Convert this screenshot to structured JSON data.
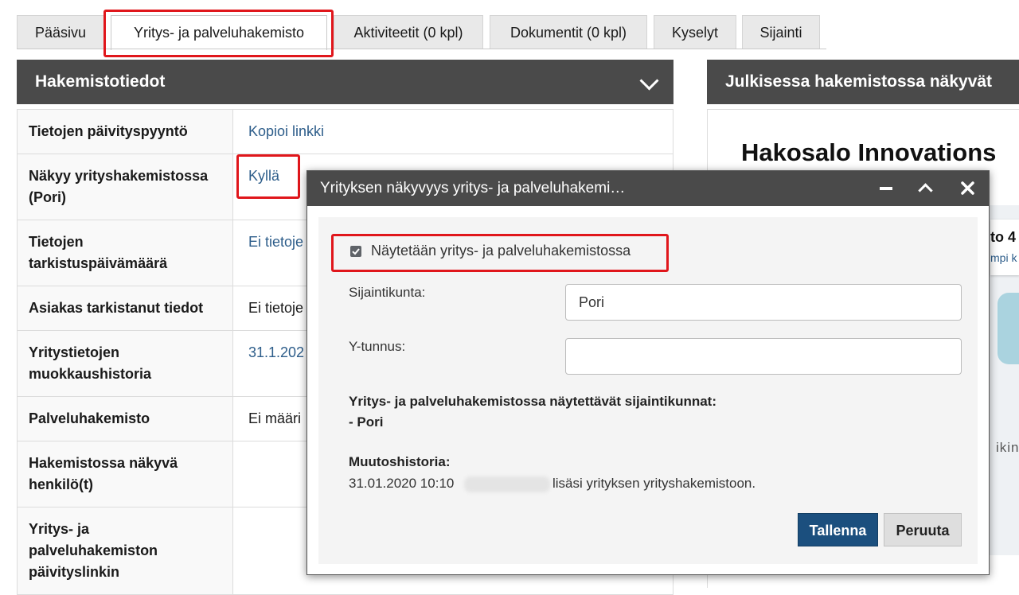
{
  "tabs": [
    {
      "label": "Pääsivu"
    },
    {
      "label": "Yritys- ja palveluhakemisto"
    },
    {
      "label": "Aktiviteetit (0 kpl)"
    },
    {
      "label": "Dokumentit (0 kpl)"
    },
    {
      "label": "Kyselyt"
    },
    {
      "label": "Sijainti"
    }
  ],
  "left_panel": {
    "title": "Hakemistotiedot",
    "rows": [
      {
        "label": "Tietojen päivityspyyntö",
        "value": "Kopioi linkki"
      },
      {
        "label": "Näkyy yrityshakemistossa (Pori)",
        "value": "Kyllä"
      },
      {
        "label": "Tietojen tarkistuspäivämäärä",
        "value": "Ei tietoje"
      },
      {
        "label": "Asiakas tarkistanut tiedot",
        "value": "Ei tietoje"
      },
      {
        "label": "Yritystietojen muokkaushistoria",
        "value": "31.1.202"
      },
      {
        "label": "Palveluhakemisto",
        "value": "Ei määri"
      },
      {
        "label": "Hakemistossa näkyvä henkilö(t)",
        "value": ""
      },
      {
        "label": "Yritys- ja palveluhakemiston päivityslinkin",
        "value": ""
      }
    ]
  },
  "right_panel": {
    "title": "Julkisessa hakemistossa näkyvät",
    "company_name": "Hakosalo Innovations",
    "map_texts": [
      "to 4",
      "mpi k",
      "ikin"
    ]
  },
  "dialog": {
    "title": "Yrityksen näkyvyys yritys- ja palveluhakemi…",
    "checkbox_label": "Näytetään yritys- ja palveluhakemistossa",
    "checkbox_checked": true,
    "municipality_label": "Sijaintikunta:",
    "municipality_value": "Pori",
    "business_id_label": "Y-tunnus:",
    "business_id_value": "",
    "shown_municipalities_title": "Yritys- ja palveluhakemistossa näytettävät sijaintikunnat:",
    "shown_municipalities_item": "- Pori",
    "history_title": "Muutoshistoria:",
    "history_date": "31.01.2020 10:10",
    "history_text": "lisäsi yrityksen yrityshakemistoon.",
    "save_label": "Tallenna",
    "cancel_label": "Peruuta",
    "minimize_icon": "minimize-icon",
    "collapse_icon": "chevron-up-icon",
    "close_icon": "close-icon"
  },
  "colors": {
    "highlight": "#e0161b",
    "header": "#4a4a4a",
    "link": "#2d5d8a",
    "primary_button": "#1b4f7e"
  }
}
